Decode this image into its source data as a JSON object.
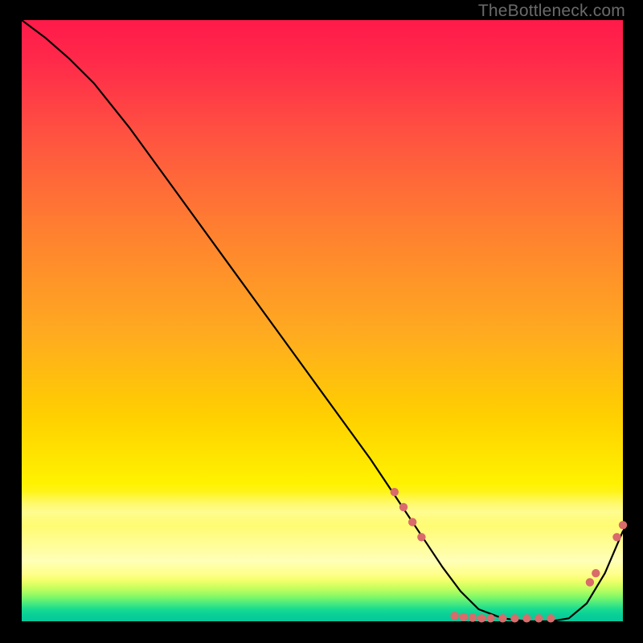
{
  "watermark": "TheBottleneck.com",
  "chart_data": {
    "type": "line",
    "title": "",
    "xlabel": "",
    "ylabel": "",
    "xlim": [
      0,
      100
    ],
    "ylim": [
      0,
      100
    ],
    "note": "Axes are unlabeled; values are percent of plot area read from the image.",
    "series": [
      {
        "name": "curve",
        "x": [
          0,
          4,
          8,
          12,
          18,
          26,
          34,
          42,
          50,
          58,
          62,
          66,
          70,
          73,
          76,
          80,
          84,
          88,
          91,
          94,
          97,
          100
        ],
        "y": [
          100,
          97,
          93.5,
          89.5,
          82,
          71,
          60,
          49,
          38,
          27,
          21,
          15,
          9,
          5,
          2,
          0.5,
          0,
          0,
          0.5,
          3,
          8,
          15
        ]
      }
    ],
    "points": [
      {
        "x": 62.0,
        "y": 21.5
      },
      {
        "x": 63.5,
        "y": 19.0
      },
      {
        "x": 65.0,
        "y": 16.5
      },
      {
        "x": 66.5,
        "y": 14.0
      },
      {
        "x": 72.0,
        "y": 0.9
      },
      {
        "x": 73.5,
        "y": 0.7
      },
      {
        "x": 75.0,
        "y": 0.6
      },
      {
        "x": 76.5,
        "y": 0.5
      },
      {
        "x": 78.0,
        "y": 0.5
      },
      {
        "x": 80.0,
        "y": 0.5
      },
      {
        "x": 82.0,
        "y": 0.5
      },
      {
        "x": 84.0,
        "y": 0.5
      },
      {
        "x": 86.0,
        "y": 0.5
      },
      {
        "x": 88.0,
        "y": 0.5
      },
      {
        "x": 94.5,
        "y": 6.5
      },
      {
        "x": 95.5,
        "y": 8.0
      },
      {
        "x": 99.0,
        "y": 14.0
      },
      {
        "x": 100.0,
        "y": 16.0
      }
    ],
    "gradient_stops": [
      {
        "pos": 0.0,
        "color": "#ff1a4a"
      },
      {
        "pos": 0.5,
        "color": "#ffc400"
      },
      {
        "pos": 0.8,
        "color": "#fff95a"
      },
      {
        "pos": 0.92,
        "color": "#ffff90"
      },
      {
        "pos": 1.0,
        "color": "#06c79a"
      }
    ]
  }
}
